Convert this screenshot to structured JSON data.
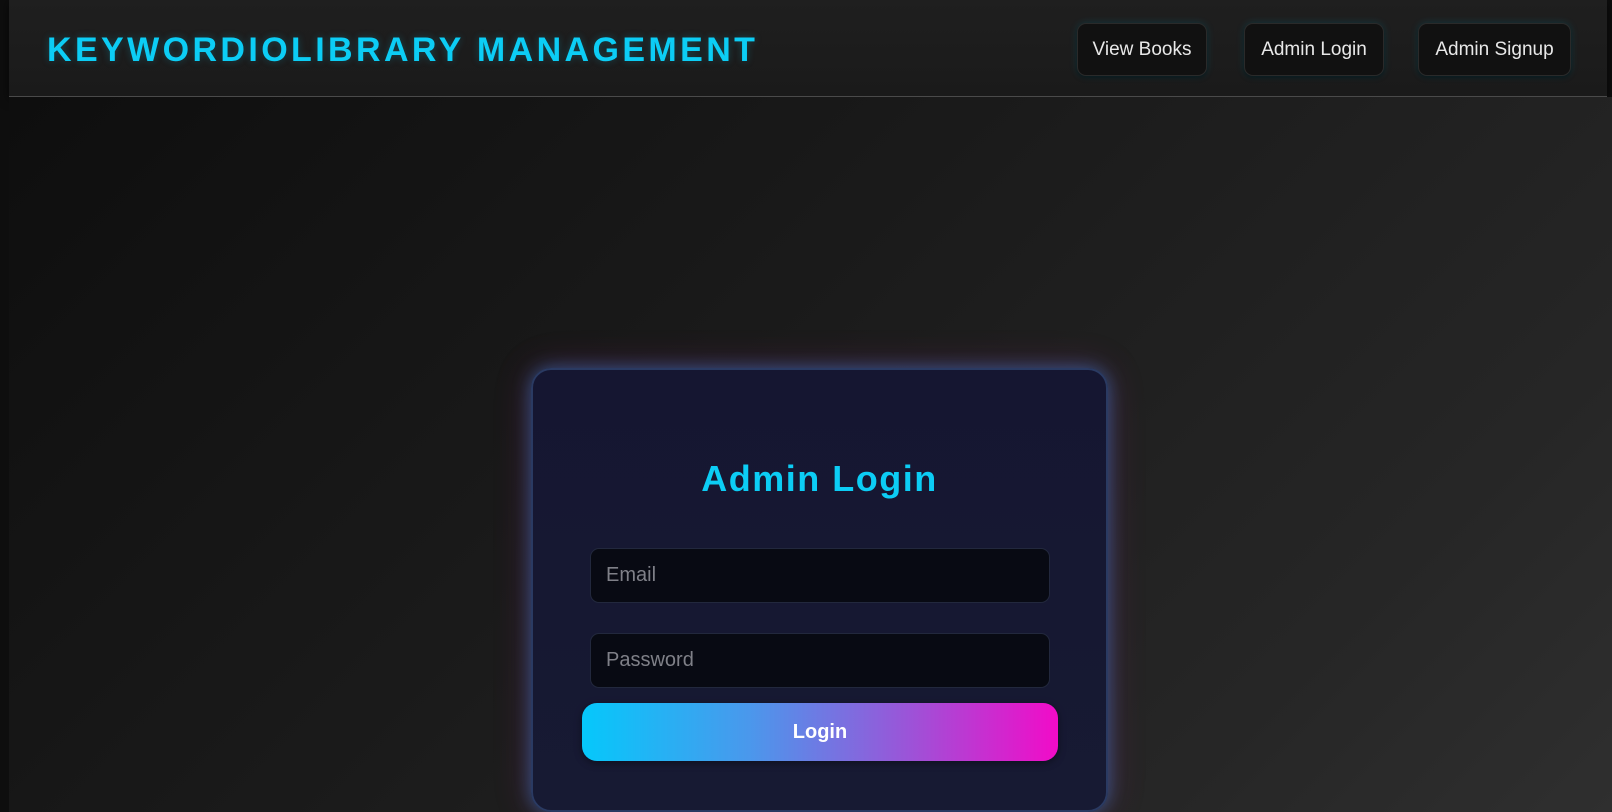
{
  "header": {
    "brand": "KEYWORDIOLIBRARY MANAGEMENT",
    "nav": [
      {
        "label": "View Books"
      },
      {
        "label": "Admin Login"
      },
      {
        "label": "Admin Signup"
      }
    ]
  },
  "login_card": {
    "title": "Admin Login",
    "email_placeholder": "Email",
    "email_value": "",
    "password_placeholder": "Password",
    "password_value": "",
    "submit_label": "Login"
  },
  "colors": {
    "accent": "#0ccdf5",
    "gradient_start": "#05c8fb",
    "gradient_end": "#f20bc8",
    "card_bg": "#151631"
  }
}
